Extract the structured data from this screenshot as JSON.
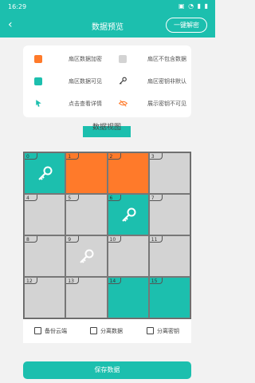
{
  "status_bar": {
    "time": "16:29",
    "icons": "▣ ◔ ▮ ▮"
  },
  "header": {
    "back": "‹",
    "title": "数据预览",
    "action": "一键解密"
  },
  "legend": {
    "encrypted": "扇区数据加密",
    "not_included": "扇区不包含数据",
    "visible": "扇区数据可见",
    "key_not_default": "扇区密钥非默认",
    "click_details": "点击查看详情",
    "key_hidden": "展示密钥不可见"
  },
  "section_title": "数据视图",
  "colors": {
    "accent": "#1cbfae",
    "encrypted": "#ff7a2a",
    "empty": "#d3d3d3",
    "visible": "#1cbfae"
  },
  "sectors": [
    {
      "index": "0",
      "state": "visible",
      "key": true
    },
    {
      "index": "1",
      "state": "encrypted",
      "key": false
    },
    {
      "index": "2",
      "state": "encrypted",
      "key": false
    },
    {
      "index": "3",
      "state": "empty",
      "key": false
    },
    {
      "index": "4",
      "state": "empty",
      "key": false
    },
    {
      "index": "5",
      "state": "empty",
      "key": false
    },
    {
      "index": "6",
      "state": "visible",
      "key": true
    },
    {
      "index": "7",
      "state": "empty",
      "key": false
    },
    {
      "index": "8",
      "state": "empty",
      "key": false
    },
    {
      "index": "9",
      "state": "empty",
      "key": true
    },
    {
      "index": "10",
      "state": "empty",
      "key": false
    },
    {
      "index": "11",
      "state": "empty",
      "key": false
    },
    {
      "index": "12",
      "state": "empty",
      "key": false
    },
    {
      "index": "13",
      "state": "empty",
      "key": false
    },
    {
      "index": "14",
      "state": "visible",
      "key": false
    },
    {
      "index": "15",
      "state": "visible",
      "key": false
    }
  ],
  "options": {
    "backup_cloud": "备份云端",
    "separate_data": "分离数据",
    "separate_key": "分离密钥"
  },
  "save_button": "保存数据"
}
